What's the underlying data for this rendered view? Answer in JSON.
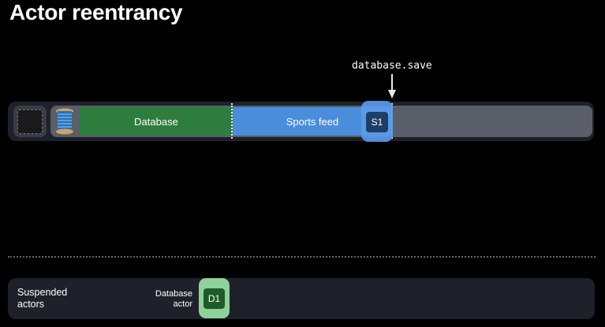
{
  "title": "Actor reentrancy",
  "annotation": "database.save",
  "thread": {
    "segments": [
      {
        "label": "Database",
        "color": "#2e7d3e"
      },
      {
        "label": "Sports feed",
        "color": "#4a8ddb"
      }
    ],
    "active_task": "S1",
    "active_task_color": "#5b9bea",
    "icons": [
      "cpu-chip-icon",
      "thread-spool-icon"
    ]
  },
  "suspended": {
    "label_line1": "Suspended",
    "label_line2": "actors",
    "actor_label_line1": "Database",
    "actor_label_line2": "actor",
    "task": "D1",
    "task_color": "#8fd19a"
  }
}
